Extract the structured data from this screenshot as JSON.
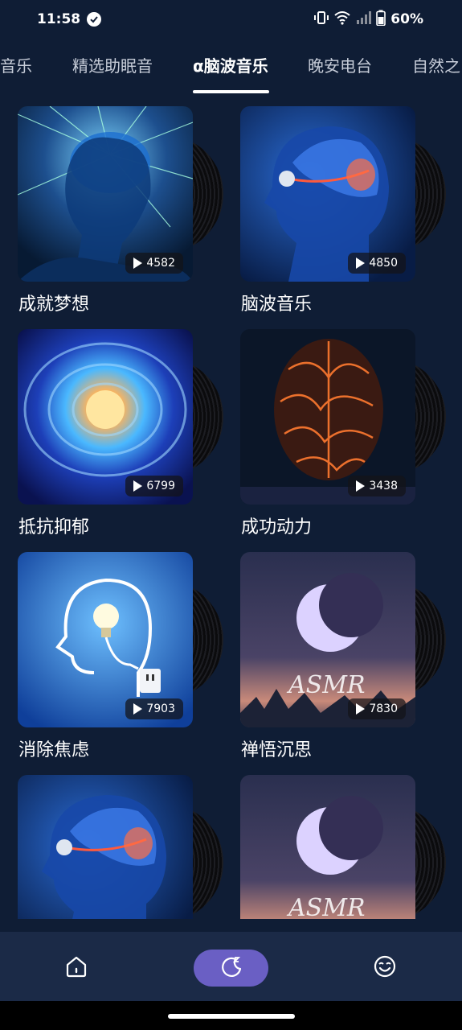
{
  "status_bar": {
    "time": "11:58",
    "battery_text": "60%"
  },
  "tabs": [
    {
      "label": "音乐"
    },
    {
      "label": "精选助眠音"
    },
    {
      "label": "α脑波音乐",
      "active": true
    },
    {
      "label": "晚安电台"
    },
    {
      "label": "自然之"
    }
  ],
  "cards": [
    {
      "title": "成就梦想",
      "count": "4582",
      "cover": "brain-rays"
    },
    {
      "title": "脑波音乐",
      "count": "4850",
      "cover": "head-profile-brain"
    },
    {
      "title": "抵抗抑郁",
      "count": "6799",
      "cover": "galaxy-spiral"
    },
    {
      "title": "成功动力",
      "count": "3438",
      "cover": "fiery-brain"
    },
    {
      "title": "消除焦虑",
      "count": "7903",
      "cover": "head-lightbulb"
    },
    {
      "title": "禅悟沉思",
      "count": "7830",
      "cover": "asmr-moon",
      "cover_text": "ASMR"
    },
    {
      "title": "",
      "count": "",
      "cover": "head-profile-brain"
    },
    {
      "title": "",
      "count": "",
      "cover": "asmr-moon",
      "cover_text": "ASMR"
    }
  ],
  "bottom_nav": [
    {
      "icon": "home-icon"
    },
    {
      "icon": "moon-sleep-icon",
      "active": true
    },
    {
      "icon": "wink-face-icon"
    }
  ],
  "colors": {
    "background": "#0f1d35",
    "nav_background": "#1b2a47",
    "accent": "#6a5fc4"
  }
}
